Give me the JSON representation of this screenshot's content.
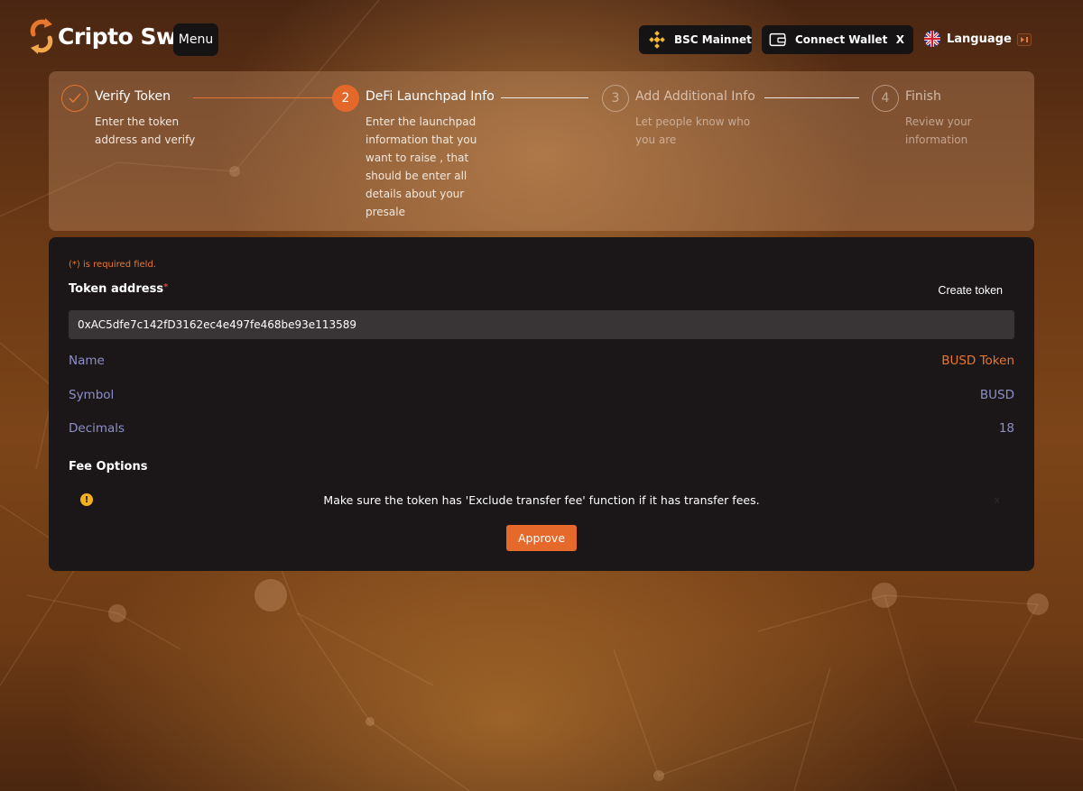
{
  "header": {
    "logo_text": "Cripto Swap",
    "menu_label": "Menu",
    "network_label": "BSC Mainnet",
    "wallet_label": "Connect Wallet",
    "wallet_close": "X",
    "language_label": "Language"
  },
  "stepper": {
    "steps": [
      {
        "number": "",
        "title": "Verify Token",
        "desc": "Enter the token address and verify",
        "state": "done"
      },
      {
        "number": "2",
        "title": "DeFi Launchpad Info",
        "desc": "Enter the launchpad information that you want to raise , that should be enter all details about your presale",
        "state": "active"
      },
      {
        "number": "3",
        "title": "Add Additional Info",
        "desc": "Let people know who you are",
        "state": "pending"
      },
      {
        "number": "4",
        "title": "Finish",
        "desc": "Review your information",
        "state": "pending"
      }
    ]
  },
  "form": {
    "required_note": "(*) is required field.",
    "token_address_label": "Token address",
    "required_star": "*",
    "create_token_label": "Create token",
    "token_address_value": "0xAC5dfe7c142fD3162ec4e497fe468be93e113589",
    "info": [
      {
        "key": "Name",
        "value": "BUSD Token"
      },
      {
        "key": "Symbol",
        "value": "BUSD"
      },
      {
        "key": "Decimals",
        "value": "18"
      }
    ],
    "fee_options_label": "Fee Options",
    "warning_icon": "!",
    "warning_text": "Make sure the token has 'Exclude transfer fee' function if it has transfer fees.",
    "warning_close": "x",
    "approve_label": "Approve"
  },
  "colors": {
    "accent": "#e4692b",
    "panel_bg": "#1b1718",
    "info_text": "#8d8fc8",
    "warning": "#f3b11c"
  },
  "icons": {
    "logo": "swap-arrows-icon",
    "network": "binance-icon",
    "wallet": "wallet-icon",
    "language": "uk-flag-icon",
    "step_done": "checkmark-icon",
    "warning": "warning-icon"
  }
}
